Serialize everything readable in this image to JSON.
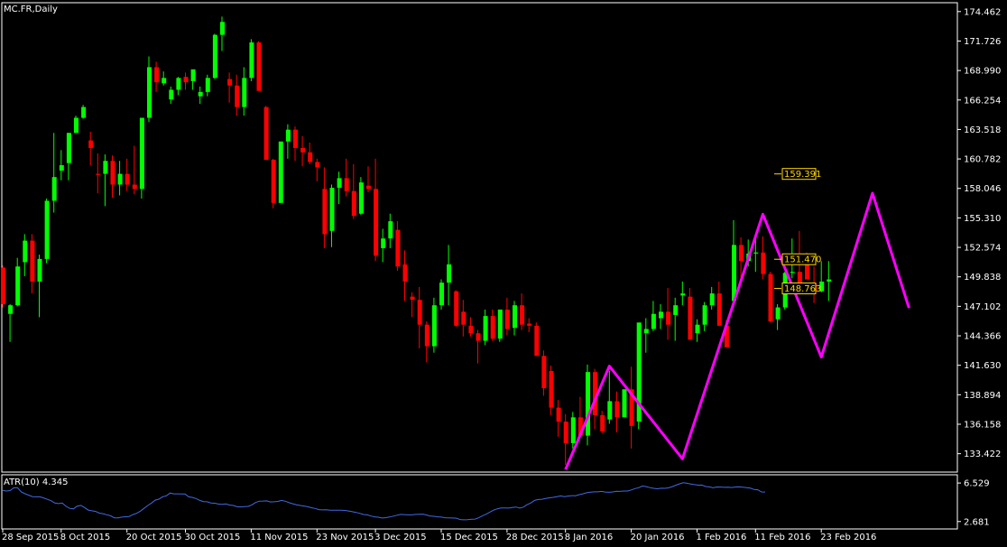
{
  "chart_data": [
    {
      "type": "candlestick",
      "title": "MC.FR,Daily",
      "ylim": [
        131.8,
        175.2
      ],
      "y_ticks": [
        "174.462",
        "171.726",
        "168.990",
        "166.254",
        "163.518",
        "160.782",
        "158.046",
        "155.310",
        "152.574",
        "149.838",
        "147.102",
        "144.366",
        "141.630",
        "138.894",
        "136.158",
        "133.422"
      ],
      "x_tick_labels": [
        "28 Sep 2015",
        "8 Oct 2015",
        "20 Oct 2015",
        "30 Oct 2015",
        "11 Nov 2015",
        "23 Nov 2015",
        "3 Dec 2015",
        "15 Dec 2015",
        "28 Dec 2015",
        "8 Jan 2016",
        "20 Jan 2016",
        "1 Feb 2016",
        "11 Feb 2016",
        "23 Feb 2016"
      ],
      "x_tick_index": [
        0,
        8,
        17,
        25,
        34,
        43,
        51,
        60,
        69,
        77,
        86,
        95,
        103,
        112
      ],
      "colors": {
        "up": "#00ff00",
        "down": "#ff0000",
        "zigzag": "#ff00ff",
        "price_label": "#ffd700"
      },
      "candles": [
        [
          150.7,
          150.9,
          147.0,
          147.3
        ],
        [
          146.4,
          147.3,
          143.8,
          147.2
        ],
        [
          147.2,
          151.6,
          147.1,
          150.8
        ],
        [
          151.2,
          153.8,
          149.9,
          153.2
        ],
        [
          153.2,
          153.8,
          148.3,
          149.4
        ],
        [
          149.4,
          151.9,
          146.1,
          151.5
        ],
        [
          151.5,
          157.1,
          151.1,
          156.9
        ],
        [
          156.9,
          163.2,
          155.8,
          159.1
        ],
        [
          159.7,
          161.6,
          158.8,
          160.2
        ],
        [
          160.4,
          163.2,
          158.8,
          163.2
        ],
        [
          163.2,
          164.8,
          163.2,
          164.6
        ],
        [
          164.6,
          165.8,
          164.5,
          165.6
        ],
        [
          162.5,
          163.3,
          160.2,
          161.8
        ],
        [
          159.4,
          161.3,
          157.6,
          159.3
        ],
        [
          159.4,
          161.2,
          156.4,
          160.6
        ],
        [
          160.6,
          161.1,
          157.2,
          158.4
        ],
        [
          158.4,
          160.6,
          157.4,
          159.4
        ],
        [
          159.4,
          160.8,
          157.8,
          158.4
        ],
        [
          158.4,
          162.0,
          157.5,
          158.0
        ],
        [
          158.0,
          161.6,
          157.1,
          164.6
        ],
        [
          164.6,
          170.3,
          164.2,
          169.3
        ],
        [
          169.3,
          169.8,
          167.0,
          167.9
        ],
        [
          167.8,
          168.9,
          167.6,
          168.3
        ],
        [
          166.3,
          167.5,
          165.9,
          167.2
        ],
        [
          167.2,
          168.4,
          166.7,
          168.3
        ],
        [
          168.4,
          168.8,
          167.2,
          167.9
        ],
        [
          168.0,
          169.0,
          167.2,
          169.1
        ],
        [
          166.6,
          167.5,
          165.9,
          167.0
        ],
        [
          167.0,
          168.6,
          166.6,
          168.3
        ],
        [
          168.3,
          172.4,
          168.2,
          172.3
        ],
        [
          172.3,
          174.0,
          170.8,
          173.5
        ],
        [
          168.2,
          168.8,
          166.0,
          167.6
        ],
        [
          167.6,
          168.6,
          164.8,
          165.6
        ],
        [
          165.6,
          169.3,
          164.8,
          168.3
        ],
        [
          168.3,
          171.9,
          168.0,
          171.6
        ],
        [
          171.6,
          171.7,
          167.1,
          167.1
        ],
        [
          165.6,
          165.7,
          160.7,
          160.7
        ],
        [
          160.7,
          160.8,
          156.2,
          156.7
        ],
        [
          156.7,
          161.9,
          156.7,
          162.4
        ],
        [
          162.4,
          164.0,
          160.8,
          163.5
        ],
        [
          163.5,
          163.8,
          160.6,
          161.8
        ],
        [
          161.8,
          162.9,
          160.1,
          161.4
        ],
        [
          161.4,
          162.3,
          160.3,
          160.5
        ],
        [
          160.5,
          160.8,
          158.7,
          160.0
        ],
        [
          158.0,
          160.0,
          152.5,
          153.8
        ],
        [
          154.1,
          158.4,
          152.6,
          158.1
        ],
        [
          158.1,
          159.6,
          156.6,
          159.0
        ],
        [
          159.0,
          160.8,
          157.3,
          157.8
        ],
        [
          157.8,
          160.3,
          155.2,
          155.5
        ],
        [
          155.7,
          159.1,
          155.6,
          158.6
        ],
        [
          158.3,
          160.1,
          157.7,
          158.0
        ],
        [
          158.0,
          160.8,
          151.3,
          151.8
        ],
        [
          152.5,
          154.3,
          151.2,
          153.4
        ],
        [
          153.4,
          155.7,
          152.5,
          155.0
        ],
        [
          154.2,
          155.0,
          150.4,
          150.8
        ],
        [
          151.0,
          152.3,
          147.6,
          149.4
        ],
        [
          148.0,
          148.4,
          146.1,
          147.7
        ],
        [
          147.7,
          148.9,
          143.2,
          145.4
        ],
        [
          145.4,
          145.7,
          141.9,
          143.4
        ],
        [
          143.4,
          147.9,
          142.8,
          147.2
        ],
        [
          147.2,
          149.6,
          146.8,
          149.3
        ],
        [
          149.3,
          152.8,
          147.2,
          151.0
        ],
        [
          148.5,
          148.6,
          145.2,
          145.3
        ],
        [
          146.6,
          147.7,
          144.3,
          145.4
        ],
        [
          145.3,
          146.1,
          144.3,
          144.6
        ],
        [
          144.6,
          144.9,
          141.8,
          143.9
        ],
        [
          143.9,
          146.8,
          143.5,
          146.2
        ],
        [
          146.2,
          146.8,
          143.9,
          144.1
        ],
        [
          144.1,
          146.8,
          143.8,
          146.8
        ],
        [
          146.8,
          147.9,
          144.4,
          145.0
        ],
        [
          145.1,
          147.6,
          144.4,
          147.2
        ],
        [
          147.2,
          148.3,
          144.9,
          145.4
        ],
        [
          145.5,
          146.0,
          144.7,
          145.3
        ],
        [
          145.3,
          145.6,
          142.7,
          142.5
        ],
        [
          142.5,
          143.0,
          138.8,
          139.5
        ],
        [
          141.1,
          141.6,
          137.0,
          137.7
        ],
        [
          137.7,
          138.4,
          135.0,
          136.4
        ],
        [
          136.4,
          137.1,
          132.4,
          134.4
        ],
        [
          134.4,
          137.3,
          133.9,
          136.8
        ],
        [
          136.8,
          138.7,
          134.9,
          135.1
        ],
        [
          135.1,
          141.7,
          134.2,
          141.0
        ],
        [
          141.0,
          141.3,
          135.7,
          137.0
        ],
        [
          137.0,
          137.4,
          135.3,
          135.5
        ],
        [
          136.6,
          141.1,
          136.2,
          138.3
        ],
        [
          138.3,
          139.2,
          135.4,
          136.8
        ],
        [
          136.8,
          139.3,
          136.8,
          139.4
        ],
        [
          139.4,
          141.5,
          133.9,
          136.0
        ],
        [
          136.4,
          145.2,
          135.7,
          145.6
        ],
        [
          144.6,
          146.0,
          142.8,
          145.0
        ],
        [
          145.0,
          147.6,
          144.8,
          146.4
        ],
        [
          146.0,
          147.3,
          145.0,
          146.6
        ],
        [
          146.6,
          148.8,
          144.0,
          145.4
        ],
        [
          146.3,
          147.9,
          143.9,
          147.2
        ],
        [
          148.1,
          149.4,
          147.2,
          148.3
        ],
        [
          148.0,
          148.8,
          144.0,
          144.0
        ],
        [
          144.6,
          145.9,
          143.8,
          145.4
        ],
        [
          145.4,
          147.5,
          144.8,
          147.2
        ],
        [
          147.2,
          148.9,
          146.8,
          148.3
        ],
        [
          148.3,
          149.4,
          146.0,
          145.3
        ],
        [
          145.3,
          145.8,
          143.6,
          143.3
        ],
        [
          147.6,
          155.1,
          147.0,
          152.8
        ],
        [
          152.8,
          153.5,
          149.6,
          151.3
        ],
        [
          151.3,
          153.3,
          150.8,
          152.0
        ],
        [
          152.0,
          153.7,
          150.3,
          152.1
        ],
        [
          152.1,
          153.6,
          149.6,
          150.1
        ],
        [
          150.1,
          150.3,
          145.6,
          145.7
        ],
        [
          145.9,
          147.3,
          144.9,
          147.0
        ],
        [
          147.0,
          150.3,
          146.8,
          150.2
        ],
        [
          150.2,
          153.4,
          149.7,
          150.3
        ],
        [
          150.3,
          154.1,
          148.7,
          149.0
        ],
        [
          151.1,
          152.1,
          149.6,
          149.6
        ],
        [
          149.2,
          150.8,
          147.4,
          148.5
        ],
        [
          148.5,
          151.3,
          148.4,
          149.4
        ],
        [
          149.4,
          151.3,
          147.6,
          149.6
        ]
      ]
    },
    {
      "type": "line",
      "title": "ATR(10) 4.345",
      "ylim": [
        2.12,
        7.08
      ],
      "y_ticks": [
        "6.529",
        "2.681"
      ],
      "colors": {
        "line": "#4169e1"
      },
      "values": [
        5.78,
        5.73,
        5.77,
        6.05,
        6.05,
        5.64,
        5.46,
        5.31,
        5.17,
        5.15,
        5.15,
        5.04,
        4.9,
        4.76,
        4.53,
        4.47,
        4.53,
        4.2,
        4.0,
        3.94,
        4.2,
        4.29,
        4.08,
        3.82,
        3.75,
        3.69,
        3.52,
        3.46,
        3.36,
        3.26,
        3.05,
        3.05,
        3.12,
        3.16,
        3.18,
        3.37,
        3.5,
        3.72,
        4.0,
        4.28,
        4.53,
        4.82,
        4.92,
        5.15,
        5.25,
        5.53,
        5.45,
        5.45,
        5.43,
        5.43,
        5.15,
        5.09,
        4.98,
        4.79,
        4.67,
        4.65,
        4.54,
        4.51,
        4.43,
        4.4,
        4.44,
        4.33,
        4.28,
        4.16,
        4.14,
        4.17,
        4.19,
        4.35,
        4.58,
        4.72,
        4.73,
        4.74,
        4.64,
        4.65,
        4.69,
        4.79,
        4.71,
        4.56,
        4.46,
        4.36,
        4.28,
        4.23,
        4.16,
        4.06,
        3.99,
        3.87,
        3.84,
        3.86,
        3.81,
        3.81,
        3.81,
        3.81,
        3.79,
        3.73,
        3.66,
        3.59,
        3.5,
        3.38,
        3.35,
        3.23,
        3.15,
        3.11,
        3.03,
        3.07,
        3.13,
        3.22,
        3.31,
        3.39,
        3.37,
        3.35,
        3.35,
        3.39,
        3.41,
        3.42,
        3.33,
        3.22,
        3.2,
        3.15,
        3.12,
        3.06,
        3.05,
        3.03,
        3.01,
        2.88,
        2.85,
        2.86,
        2.91,
        2.92,
        3.06,
        3.26,
        3.42,
        3.63,
        3.82,
        3.95,
        4.03,
        4.03,
        4.02,
        4.08,
        4.13,
        4.03,
        4.12,
        4.37,
        4.54,
        4.79,
        4.88,
        4.91,
        4.98,
        5.05,
        5.1,
        5.16,
        5.24,
        5.16,
        5.22,
        5.27,
        5.26,
        5.37,
        5.45,
        5.56,
        5.62,
        5.65,
        5.65,
        5.69,
        5.63,
        5.6,
        5.64,
        5.71,
        5.69,
        5.73,
        5.73,
        5.84,
        5.97,
        6.06,
        6.23,
        6.17,
        6.07,
        6.0,
        5.95,
        6.01,
        6.0,
        6.04,
        6.17,
        6.31,
        6.45,
        6.56,
        6.5,
        6.43,
        6.37,
        6.31,
        6.32,
        6.18,
        6.14,
        6.05,
        6.13,
        6.12,
        6.1,
        6.11,
        6.08,
        6.13,
        6.14,
        6.11,
        6.06,
        6.02,
        5.88,
        5.85,
        5.64,
        5.63
      ]
    }
  ],
  "zigzag": [
    [
      77,
      131.95
    ],
    [
      83,
      141.55
    ],
    [
      93,
      132.95
    ],
    [
      104,
      155.65
    ],
    [
      112,
      142.4
    ],
    [
      119,
      157.6
    ],
    [
      124,
      146.95
    ]
  ],
  "price_labels": [
    "159.391",
    "151.470",
    "148.763"
  ],
  "price_label_values": [
    159.391,
    151.47,
    148.763
  ]
}
